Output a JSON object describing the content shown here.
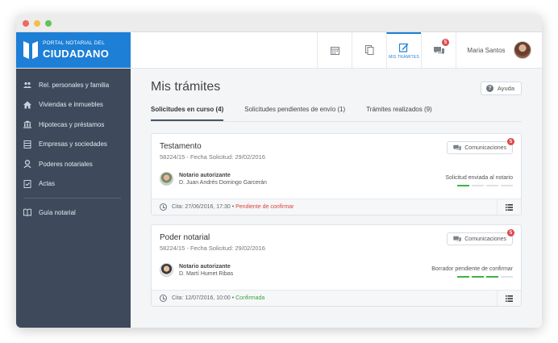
{
  "window": {
    "dots": [
      "#ee6a5e",
      "#f5bd4f",
      "#61c454"
    ]
  },
  "brand": {
    "line1": "PORTAL NOTARIAL DEL",
    "line2": "CIUDADANO",
    "color": "#1e7fd6"
  },
  "header": {
    "buttons": [
      {
        "icon": "calendar-icon",
        "label": ""
      },
      {
        "icon": "documents-icon",
        "label": ""
      },
      {
        "icon": "edit-icon",
        "label": "MIS TRÁMITES",
        "active": true
      },
      {
        "icon": "chat-icon",
        "label": "",
        "badge": "5"
      }
    ],
    "user_name": "Maria Santos"
  },
  "sidebar": {
    "items": [
      {
        "icon": "people-icon",
        "label": "Rel. personales y familia"
      },
      {
        "icon": "house-icon",
        "label": "Viviendas e inmuebles"
      },
      {
        "icon": "bank-icon",
        "label": "Hipotecas y préstamos"
      },
      {
        "icon": "building-icon",
        "label": "Empresas y sociedades"
      },
      {
        "icon": "user-icon",
        "label": "Poderes notariales"
      },
      {
        "icon": "checklist-icon",
        "label": "Actas"
      }
    ],
    "extra": {
      "icon": "book-icon",
      "label": "Guía notarial"
    }
  },
  "main": {
    "title": "Mis trámites",
    "help_label": "Ayuda",
    "tabs": [
      {
        "label": "Solicitudes en curso (4)",
        "active": true
      },
      {
        "label": "Solicitudes pendientes de envío (1)"
      },
      {
        "label": "Trámites realizados (9)"
      }
    ],
    "cards": [
      {
        "title": "Testamento",
        "subtitle": "58224/15 - Fecha Solicitud: 29/02/2016",
        "com_label": "Comunicaciones",
        "com_badge": "5",
        "notary_label": "Notario autorizante",
        "notary_name": "D. Juan Andrés Domingo Garcerán",
        "status": "Solicitud enviada al notario",
        "progress_steps_done": 1,
        "progress_steps_total": 4,
        "cita": "Cita: 27/06/2016, 17:30",
        "cita_sep": " • ",
        "cita_status": "Pendiente de confirmar",
        "cita_status_color": "#d9453e"
      },
      {
        "title": "Poder notarial",
        "subtitle": "58224/15 - Fecha Solicitud: 29/02/2016",
        "com_label": "Comunicaciones",
        "com_badge": "5",
        "notary_label": "Notario autorizante",
        "notary_name": "D. Martí Humet Ribas",
        "status": "Borrador pendiente de confirmar",
        "progress_steps_done": 3,
        "progress_steps_total": 4,
        "cita": "Cita: 12/07/2016, 10:00",
        "cita_sep": " • ",
        "cita_status": "Confirmada",
        "cita_status_color": "#3aa442"
      }
    ]
  }
}
